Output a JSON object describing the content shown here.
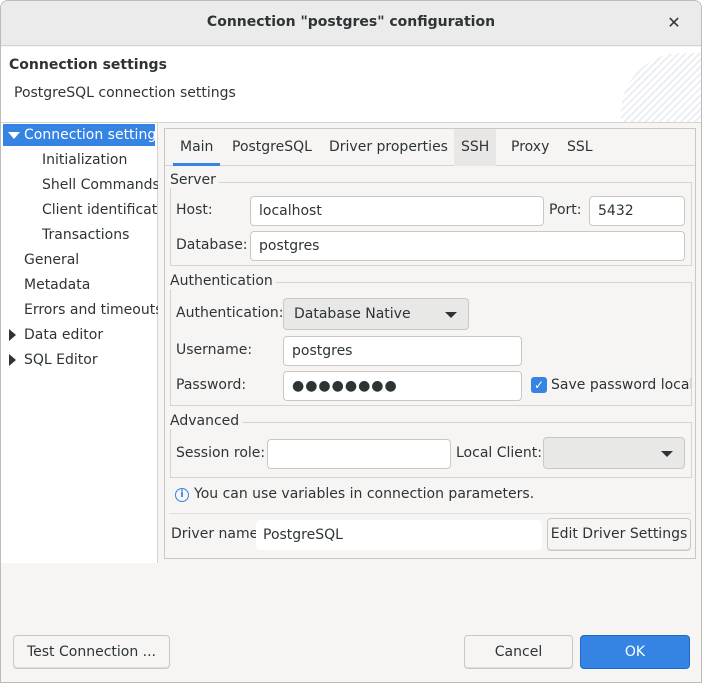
{
  "window": {
    "title": "Connection \"postgres\" configuration",
    "close_glyph": "✕"
  },
  "header": {
    "title": "Connection settings",
    "subtitle": "PostgreSQL connection settings"
  },
  "nav": {
    "items": [
      {
        "label": "Connection settings",
        "expanded": true,
        "selected": true
      },
      {
        "label": "Initialization"
      },
      {
        "label": "Shell Commands"
      },
      {
        "label": "Client identification"
      },
      {
        "label": "Transactions"
      },
      {
        "label": "General"
      },
      {
        "label": "Metadata"
      },
      {
        "label": "Errors and timeouts"
      },
      {
        "label": "Data editor",
        "expandable": true
      },
      {
        "label": "SQL Editor",
        "expandable": true
      }
    ]
  },
  "tabs": [
    {
      "label": "Main",
      "active": true
    },
    {
      "label": "PostgreSQL"
    },
    {
      "label": "Driver properties"
    },
    {
      "label": "SSH"
    },
    {
      "label": "Proxy"
    },
    {
      "label": "SSL"
    }
  ],
  "server": {
    "group_label": "Server",
    "host_label": "Host:",
    "host_value": "localhost",
    "port_label": "Port:",
    "port_value": "5432",
    "database_label": "Database:",
    "database_value": "postgres"
  },
  "auth": {
    "group_label": "Authentication",
    "auth_label": "Authentication:",
    "auth_value": "Database Native",
    "username_label": "Username:",
    "username_value": "postgres",
    "password_label": "Password:",
    "password_value": "●●●●●●●●",
    "save_password_label": "Save password locall",
    "save_password_checked": true
  },
  "advanced": {
    "group_label": "Advanced",
    "session_role_label": "Session role:",
    "session_role_value": "",
    "local_client_label": "Local Client:",
    "local_client_value": ""
  },
  "info": {
    "text": "You can use variables in connection parameters.",
    "icon": "info-icon"
  },
  "driver": {
    "label": "Driver name:",
    "value": "PostgreSQL",
    "edit_button": "Edit Driver Settings"
  },
  "footer": {
    "test_button": "Test Connection ...",
    "cancel_button": "Cancel",
    "ok_button": "OK"
  },
  "colors": {
    "accent": "#3584e4",
    "background": "#f6f5f4"
  }
}
